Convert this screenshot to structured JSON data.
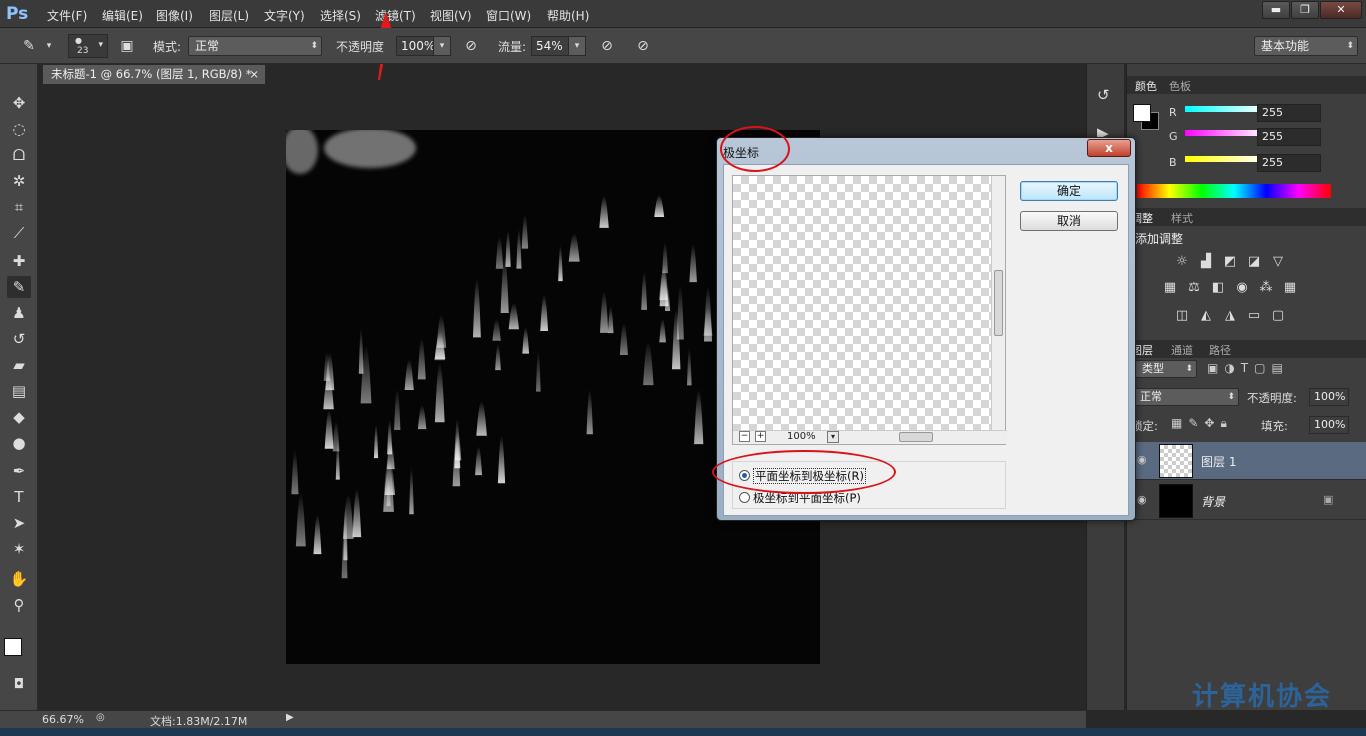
{
  "app": {
    "logo": "Ps"
  },
  "menu": [
    "文件(F)",
    "编辑(E)",
    "图像(I)",
    "图层(L)",
    "文字(Y)",
    "选择(S)",
    "滤镜(T)",
    "视图(V)",
    "窗口(W)",
    "帮助(H)"
  ],
  "options": {
    "brush_size": "23",
    "mode_label": "模式:",
    "mode_value": "正常",
    "opacity_label": "不透明度",
    "opacity_value": "100%",
    "flow_label": "流量:",
    "flow_value": "54%",
    "workspace": "基本功能"
  },
  "document": {
    "tab_title": "未标题-1 @ 66.7% (图层 1, RGB/8) *",
    "tab_close": "×"
  },
  "status": {
    "zoom": "66.67%",
    "doc_info": "文档:1.83M/2.17M"
  },
  "dialog": {
    "title": "极坐标",
    "close": "x",
    "ok": "确定",
    "cancel": "取消",
    "zoom": "100%",
    "zoom_out": "−",
    "zoom_in": "+",
    "option_rect_to_polar": "平面坐标到极坐标(R)",
    "option_polar_to_rect": "极坐标到平面坐标(P)",
    "selected_option": "rect_to_polar"
  },
  "color_panel": {
    "tabs": [
      "颜色",
      "色板"
    ],
    "r_label": "R",
    "g_label": "G",
    "b_label": "B",
    "r": "255",
    "g": "255",
    "b": "255"
  },
  "adjust_panel": {
    "tabs": [
      "调整",
      "样式"
    ],
    "title": "添加调整"
  },
  "layers_panel": {
    "tabs": [
      "图层",
      "通道",
      "路径"
    ],
    "filter_kind": "类型",
    "blend_mode": "正常",
    "opacity_label": "不透明度:",
    "opacity_value": "100%",
    "lock_label": "锁定:",
    "fill_label": "填充:",
    "fill_value": "100%",
    "layers": [
      {
        "name": "图层 1"
      },
      {
        "name": "背景"
      }
    ]
  },
  "watermark": "计算机协会"
}
